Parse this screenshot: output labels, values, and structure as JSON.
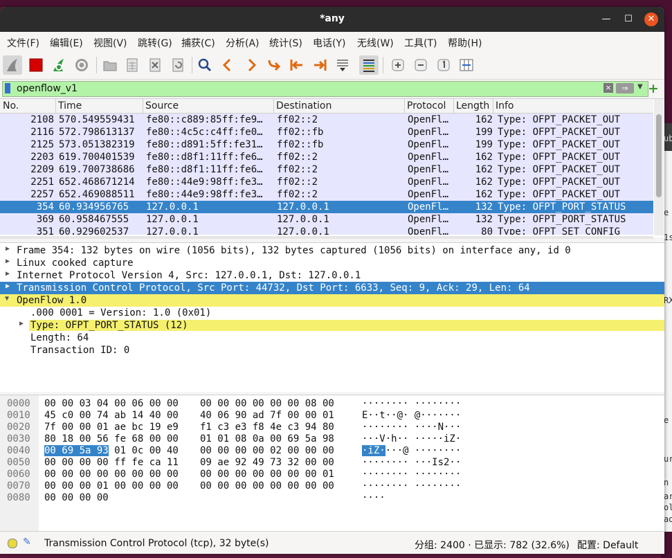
{
  "window": {
    "title": "*any"
  },
  "menu": [
    "文件(F)",
    "编辑(E)",
    "视图(V)",
    "跳转(G)",
    "捕获(C)",
    "分析(A)",
    "统计(S)",
    "电话(Y)",
    "无线(W)",
    "工具(T)",
    "帮助(H)"
  ],
  "filter": {
    "value": "openflow_v1",
    "clear_icon": "×",
    "apply_icon": "⇒",
    "add_icon": "+"
  },
  "packet_list": {
    "columns": [
      "No.",
      "Time",
      "Source",
      "Destination",
      "Protocol",
      "Length",
      "Info"
    ],
    "rows": [
      {
        "no": "2108",
        "time": "570.549559431",
        "src": "fe80::c889:85ff:fe9…",
        "dst": "ff02::2",
        "proto": "OpenFl…",
        "len": "162",
        "info": "Type: OFPT_PACKET_OUT"
      },
      {
        "no": "2116",
        "time": "572.798613137",
        "src": "fe80::4c5c:c4ff:fe0…",
        "dst": "ff02::fb",
        "proto": "OpenFl…",
        "len": "199",
        "info": "Type: OFPT_PACKET_OUT"
      },
      {
        "no": "2125",
        "time": "573.051382319",
        "src": "fe80::d891:5ff:fe31…",
        "dst": "ff02::fb",
        "proto": "OpenFl…",
        "len": "199",
        "info": "Type: OFPT_PACKET_OUT"
      },
      {
        "no": "2203",
        "time": "619.700401539",
        "src": "fe80::d8f1:11ff:fe6…",
        "dst": "ff02::2",
        "proto": "OpenFl…",
        "len": "162",
        "info": "Type: OFPT_PACKET_OUT"
      },
      {
        "no": "2209",
        "time": "619.700738686",
        "src": "fe80::d8f1:11ff:fe6…",
        "dst": "ff02::2",
        "proto": "OpenFl…",
        "len": "162",
        "info": "Type: OFPT_PACKET_OUT"
      },
      {
        "no": "2251",
        "time": "652.468671214",
        "src": "fe80::44e9:98ff:fe3…",
        "dst": "ff02::2",
        "proto": "OpenFl…",
        "len": "162",
        "info": "Type: OFPT_PACKET_OUT"
      },
      {
        "no": "2257",
        "time": "652.469088511",
        "src": "fe80::44e9:98ff:fe3…",
        "dst": "ff02::2",
        "proto": "OpenFl…",
        "len": "162",
        "info": "Type: OFPT_PACKET_OUT"
      },
      {
        "no": "354",
        "time": "60.934956765",
        "src": "127.0.0.1",
        "dst": "127.0.0.1",
        "proto": "OpenFl…",
        "len": "132",
        "info": "Type: OFPT_PORT_STATUS"
      },
      {
        "no": "369",
        "time": "60.958467555",
        "src": "127.0.0.1",
        "dst": "127.0.0.1",
        "proto": "OpenFl…",
        "len": "132",
        "info": "Type: OFPT_PORT_STATUS"
      },
      {
        "no": "351",
        "time": "60.929602537",
        "src": "127.0.0.1",
        "dst": "127.0.0.1",
        "proto": "OpenFl…",
        "len": "80",
        "info": "Type: OFPT_SET_CONFIG"
      }
    ]
  },
  "details": [
    "Frame 354: 132 bytes on wire (1056 bits), 132 bytes captured (1056 bits) on interface any, id 0",
    "Linux cooked capture",
    "Internet Protocol Version 4, Src: 127.0.0.1, Dst: 127.0.0.1",
    "Transmission Control Protocol, Src Port: 44732, Dst Port: 6633, Seq: 9, Ack: 29, Len: 64",
    "OpenFlow 1.0",
    ".000 0001 = Version: 1.0 (0x01)",
    "Type: OFPT_PORT_STATUS (12)",
    "Length: 64",
    "Transaction ID: 0"
  ],
  "bytes": [
    {
      "off": "0000",
      "h1": "00 00 03 04 00 06 00 00",
      "h2": "00 00 00 00 00 00 08 00",
      "asc": "········ ········"
    },
    {
      "off": "0010",
      "h1": "45 c0 00 74 ab 14 40 00",
      "h2": "40 06 90 ad 7f 00 00 01",
      "asc": "E··t··@· @·······"
    },
    {
      "off": "0020",
      "h1": "7f 00 00 01 ae bc 19 e9",
      "h2": "f1 c3 e3 f8 4e c3 94 80",
      "asc": "········ ····N···"
    },
    {
      "off": "0030",
      "h1": "80 18 00 56 fe 68 00 00",
      "h2": "01 01 08 0a 00 69 5a 98",
      "asc": "···V·h·· ·····iZ·"
    },
    {
      "off": "0040",
      "h1a": "00 69 5a 93",
      "h1b": " 01 0c 00 40",
      "h2": "00 00 00 00 02 00 00 00",
      "asca": "·iZ·",
      "ascb": "···@ ········"
    },
    {
      "off": "0050",
      "h1": "00 00 00 00 ff fe ca 11",
      "h2": "09 ae 92 49 73 32 00 00",
      "asc": "········ ···Is2··"
    },
    {
      "off": "0060",
      "h1": "00 00 00 00 00 00 00 00",
      "h2": "00 00 00 00 00 00 00 01",
      "asc": "········ ········"
    },
    {
      "off": "0070",
      "h1": "00 00 00 01 00 00 00 00",
      "h2": "00 00 00 00 00 00 00 00",
      "asc": "········ ········"
    },
    {
      "off": "0080",
      "h1": "00 00 00 00",
      "h2": "",
      "asc": "····"
    }
  ],
  "status": {
    "text": "Transmission Control Protocol (tcp), 32 byte(s)",
    "packets": "分组: 2400 · 已显示: 782 (32.6%)",
    "profile": "配置: Default"
  },
  "background_text": [
    "ub",
    "e",
    "1s",
    "RX",
    "e",
    "ur",
    "n",
    "ar",
    "ol",
    "ad"
  ]
}
